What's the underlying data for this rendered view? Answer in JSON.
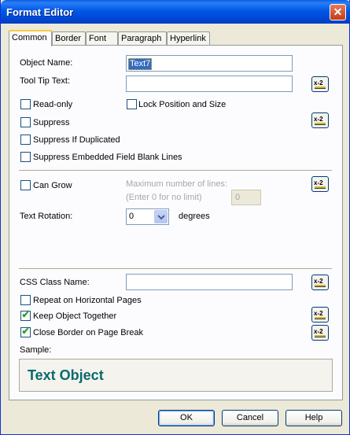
{
  "window": {
    "title": "Format Editor",
    "close_glyph": "✕"
  },
  "tabs": [
    {
      "label": "Common"
    },
    {
      "label": "Border"
    },
    {
      "label": "Font"
    },
    {
      "label": "Paragraph"
    },
    {
      "label": "Hyperlink"
    }
  ],
  "common": {
    "object_name_label": "Object Name:",
    "object_name_value": "Text7",
    "tooltip_label": "Tool Tip Text:",
    "tooltip_value": "",
    "read_only_label": "Read-only",
    "read_only_checked": false,
    "lock_position_label": "Lock Position and Size",
    "lock_position_checked": false,
    "suppress_label": "Suppress",
    "suppress_checked": false,
    "suppress_duplicated_label": "Suppress If Duplicated",
    "suppress_duplicated_checked": false,
    "suppress_blank_lines_label": "Suppress Embedded Field Blank Lines",
    "suppress_blank_lines_checked": false,
    "can_grow_label": "Can Grow",
    "can_grow_checked": false,
    "max_lines_label": "Maximum number of lines:",
    "max_lines_hint": "(Enter 0 for no limit)",
    "max_lines_value": "0",
    "text_rotation_label": "Text Rotation:",
    "text_rotation_value": "0",
    "degrees_label": "degrees",
    "css_class_label": "CSS Class Name:",
    "css_class_value": "",
    "repeat_label": "Repeat on Horizontal Pages",
    "repeat_checked": false,
    "keep_together_label": "Keep Object Together",
    "keep_together_checked": true,
    "close_border_label": "Close Border on Page Break",
    "close_border_checked": true,
    "sample_label": "Sample:",
    "sample_text": "Text Object",
    "check_glyph": "✔"
  },
  "formula_button_glyph": "x-2",
  "buttons": {
    "ok": "OK",
    "cancel": "Cancel",
    "help": "Help"
  },
  "icons": {
    "formula": "formula-icon",
    "close": "close-icon",
    "dropdown": "chevron-down-icon"
  },
  "colors": {
    "titlebar": "#0058e6",
    "sample_text": "#0a6a6a",
    "selection": "#316ac5",
    "check": "#21a121"
  }
}
